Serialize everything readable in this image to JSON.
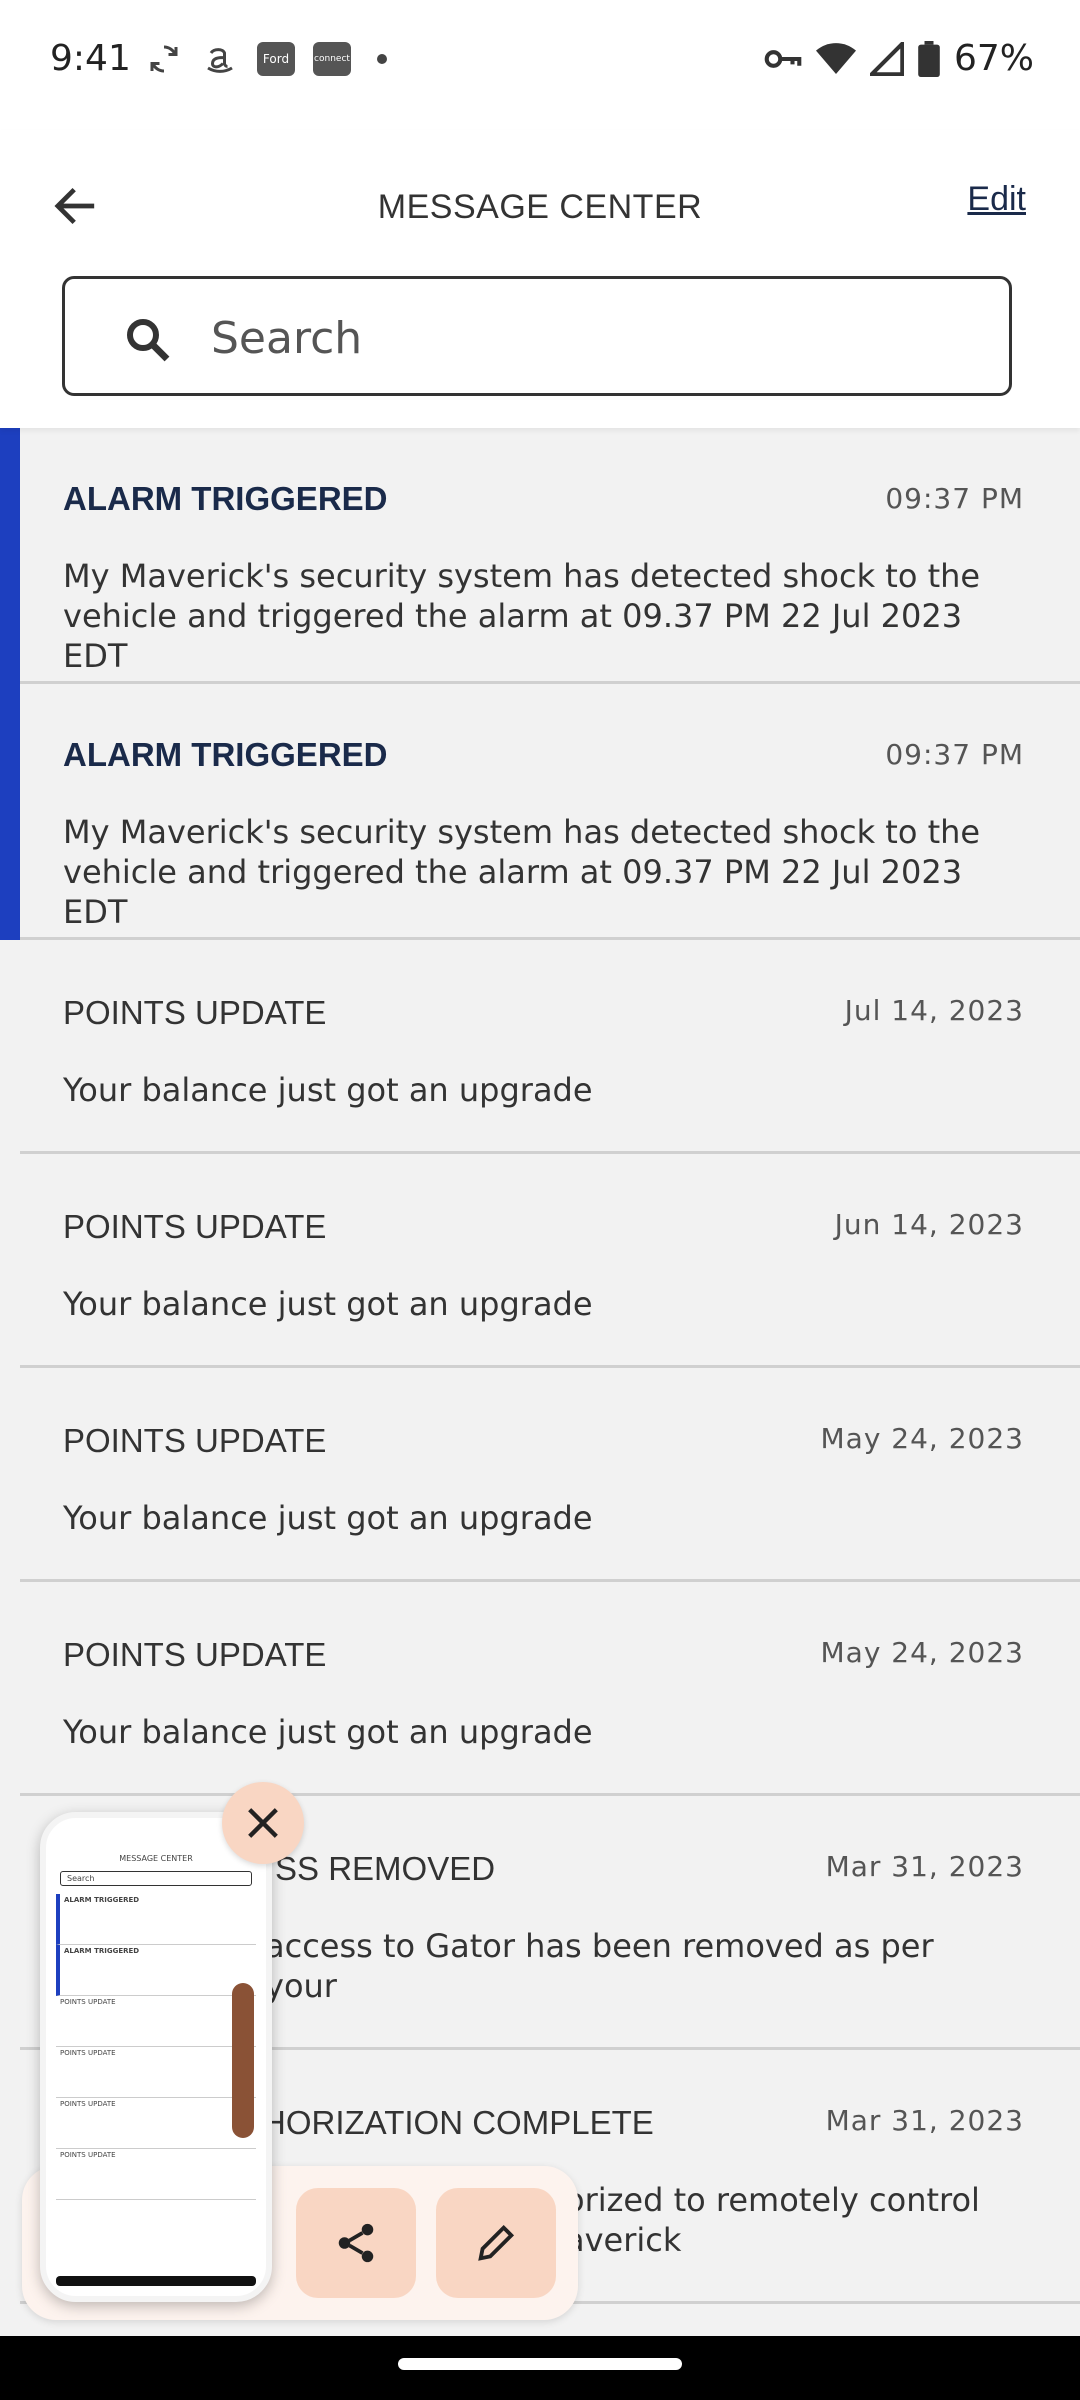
{
  "status_bar": {
    "time": "9:41",
    "battery": "67%",
    "ford_app_label": "Ford",
    "connect_app_label": "connect"
  },
  "header": {
    "title": "MESSAGE CENTER",
    "edit_label": "Edit",
    "search_placeholder": "Search"
  },
  "messages": [
    {
      "title": "ALARM TRIGGERED",
      "date": "09:37 PM",
      "body": "My Maverick's security system has detected shock to the vehicle and triggered the alarm at 09.37 PM  22 Jul 2023 EDT",
      "unread": true
    },
    {
      "title": "ALARM TRIGGERED",
      "date": "09:37 PM",
      "body": "My Maverick's security system has detected shock to the vehicle and triggered the alarm at 09.37 PM  22 Jul 2023 EDT",
      "unread": true
    },
    {
      "title": "POINTS UPDATE",
      "date": "Jul 14, 2023",
      "body": "Your balance just got an upgrade",
      "unread": false
    },
    {
      "title": "POINTS UPDATE",
      "date": "Jun 14, 2023",
      "body": "Your balance just got an upgrade",
      "unread": false
    },
    {
      "title": "POINTS UPDATE",
      "date": "May 24, 2023",
      "body": "Your balance just got an upgrade",
      "unread": false
    },
    {
      "title": "POINTS UPDATE",
      "date": "May 24, 2023",
      "body": "Your balance just got an upgrade",
      "unread": false
    },
    {
      "title": "SS REMOVED",
      "date": "Mar 31, 2023",
      "body": "access to Gator has been removed as per your",
      "unread": false
    },
    {
      "title": "HORIZATION COMPLETE",
      "date": "Mar 31, 2023",
      "body": "orized to remotely control\naverick",
      "unread": false
    }
  ],
  "preview": {
    "title": "MESSAGE CENTER",
    "search": "Search",
    "row1": "ALARM TRIGGERED",
    "row2": "ALARM TRIGGERED",
    "row3": "POINTS UPDATE"
  },
  "icons": {
    "back": "arrow-left-icon",
    "search": "search-icon",
    "close": "close-icon",
    "share": "share-icon",
    "edit": "pencil-icon"
  },
  "colors": {
    "unread_accent": "#1d3fbf",
    "action_button": "#f9d6c3",
    "list_background": "#f2f2f2"
  }
}
